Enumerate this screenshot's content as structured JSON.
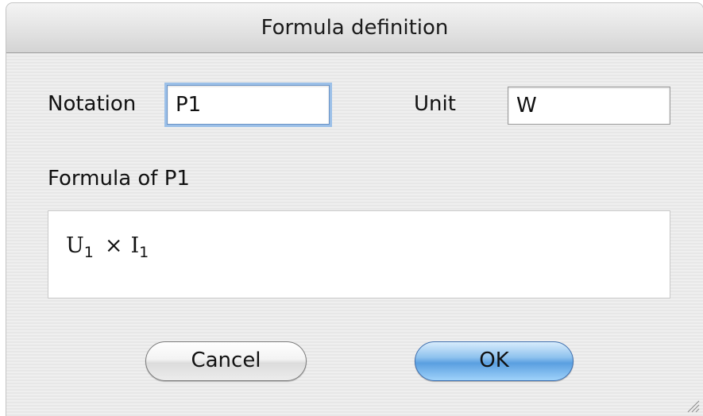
{
  "window": {
    "title": "Formula definition"
  },
  "notation": {
    "label": "Notation",
    "value": "P1"
  },
  "unit": {
    "label": "Unit",
    "value": "W"
  },
  "formula": {
    "label": "Formula of P1",
    "operand1": "U",
    "operand1_sub": "1",
    "operator": "×",
    "operand2": "I",
    "operand2_sub": "1"
  },
  "buttons": {
    "cancel_label": "Cancel",
    "ok_label": "OK"
  },
  "colors": {
    "default_button": "#5a9fe0",
    "focus_ring": "#9cc0e8"
  }
}
